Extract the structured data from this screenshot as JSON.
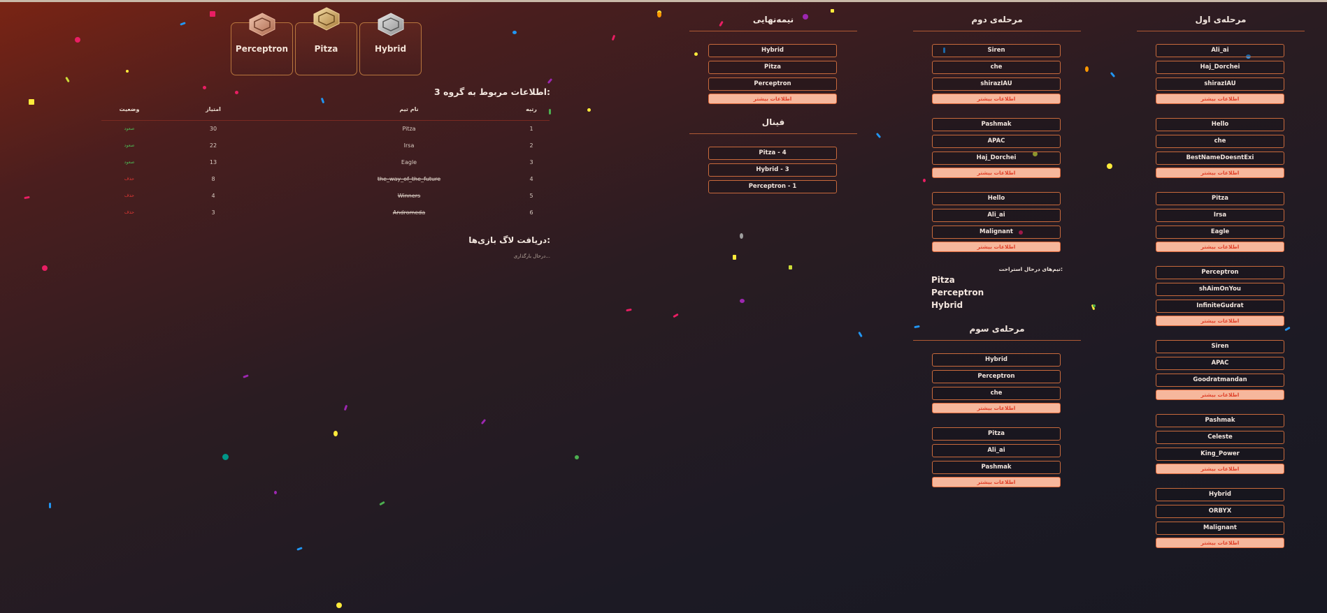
{
  "podium": [
    {
      "name": "Perceptron",
      "medal": "bronze-medal-icon"
    },
    {
      "name": "Pitza",
      "medal": "gold-medal-icon"
    },
    {
      "name": "Hybrid",
      "medal": "silver-medal-icon"
    }
  ],
  "group": {
    "title": "اطلاعات مربوط به گروه 3:",
    "headers": {
      "rank": "رتبه",
      "team": "نام تیم",
      "score": "امتیاز",
      "status": "وضعیت"
    },
    "rows": [
      {
        "rank": "1",
        "team": "Pitza",
        "score": "30",
        "status": "صعود"
      },
      {
        "rank": "2",
        "team": "Irsa",
        "score": "22",
        "status": "صعود"
      },
      {
        "rank": "3",
        "team": "Eagle",
        "score": "13",
        "status": "صعود"
      },
      {
        "rank": "4",
        "team": "the_way_of_the_future",
        "score": "8",
        "status": "حذف"
      },
      {
        "rank": "5",
        "team": "Winners",
        "score": "4",
        "status": "حذف"
      },
      {
        "rank": "6",
        "team": "Andromeda",
        "score": "3",
        "status": "حذف"
      }
    ]
  },
  "logs": {
    "title": "دریافت لاگ بازی‌ها:",
    "status": "درحال بارگذاری..."
  },
  "more_label": "اطلاعات بیشتر",
  "stages": {
    "round1": {
      "title": "مرحله‌ی اول",
      "groups": [
        [
          "Ali_ai",
          "Haj_Dorchei",
          "shirazIAU"
        ],
        [
          "Hello",
          "che",
          "BestNameDoesntExi"
        ],
        [
          "Pitza",
          "Irsa",
          "Eagle"
        ],
        [
          "Perceptron",
          "shAimOnYou",
          "InfiniteGudrat"
        ],
        [
          "Siren",
          "APAC",
          "Goodratmandan"
        ],
        [
          "Pashmak",
          "Celeste",
          "King_Power"
        ],
        [
          "Hybrid",
          "ORBYX",
          "Malignant"
        ]
      ]
    },
    "round2": {
      "title": "مرحله‌ی دوم",
      "groups": [
        [
          "Siren",
          "che",
          "shirazIAU"
        ],
        [
          "Pashmak",
          "APAC",
          "Haj_Dorchei"
        ],
        [
          "Hello",
          "Ali_ai",
          "Malignant"
        ]
      ],
      "waiting_title": "تیم‌های درحال استراحت:",
      "waiting": [
        "Pitza",
        "Perceptron",
        "Hybrid"
      ]
    },
    "round3": {
      "title": "مرحله‌ی سوم",
      "groups": [
        [
          "Hybrid",
          "Perceptron",
          "che"
        ],
        [
          "Pitza",
          "Ali_ai",
          "Pashmak"
        ]
      ]
    },
    "semifinal": {
      "title": "نیمه‌نهایی",
      "groups": [
        [
          "Hybrid",
          "Pitza",
          "Perceptron"
        ]
      ]
    },
    "final": {
      "title": "فینال",
      "results": [
        "Pitza - 4",
        "Hybrid - 3",
        "Perceptron - 1"
      ]
    }
  }
}
